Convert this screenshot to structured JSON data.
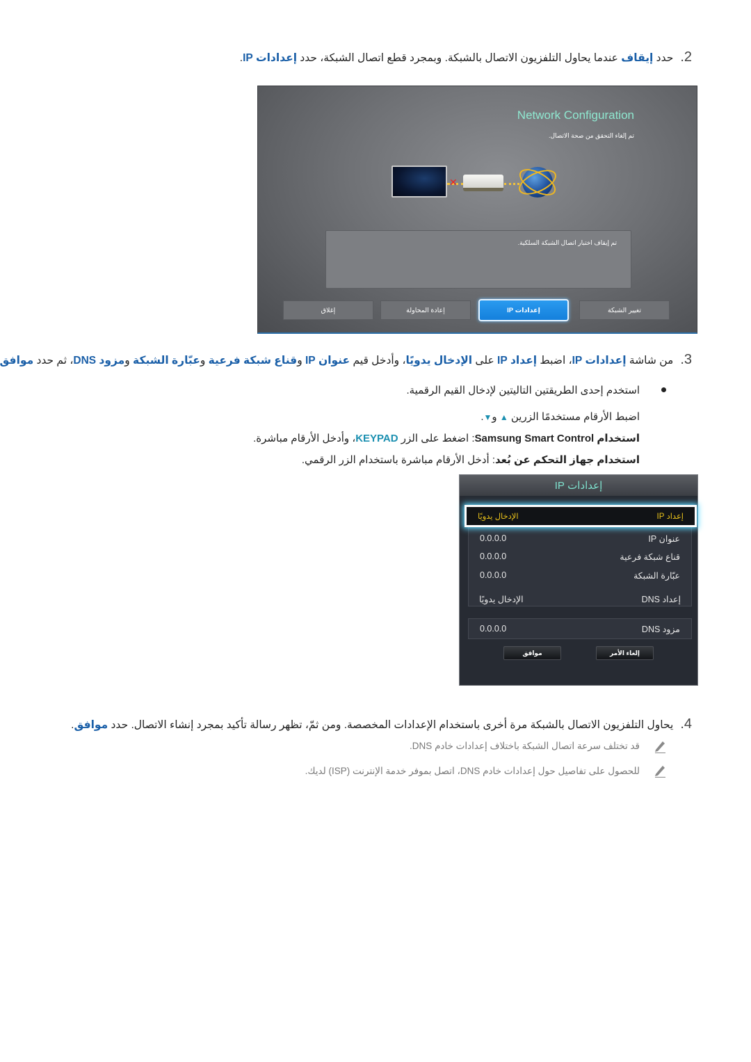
{
  "step2": {
    "number": "2.",
    "text_a": "حدد ",
    "link_stop": "إيقاف",
    "text_b": " عندما يحاول التلفزيون الاتصال بالشبكة. وبمجرد قطع اتصال الشبكة، حدد ",
    "link_ip": "إعدادات IP",
    "text_c": "."
  },
  "network_config": {
    "title": "Network Configuration",
    "subtitle": "تم إلغاء التحقق من صحة الاتصال.",
    "message": "تم إيقاف اختبار اتصال الشبكة السلكية.",
    "buttons": [
      {
        "label": "تغيير الشبكة",
        "active": false
      },
      {
        "label": "إعدادات IP",
        "active": true
      },
      {
        "label": "إعادة المحاولة",
        "active": false
      },
      {
        "label": "إغلاق",
        "active": false
      }
    ],
    "colors": {
      "title": "#8fe8d0",
      "active_button": "#1a8ae6"
    }
  },
  "step3": {
    "number": "3.",
    "t1": "من شاشة ",
    "k1": "إعدادات IP",
    "t2": "، اضبط ",
    "k2": "إعداد IP",
    "t3": " على ",
    "k3": "الإدخال يدويًا",
    "t4": "، وأدخل قيم ",
    "k4": "عنوان IP",
    "t5": " و",
    "k5": "قناع شبكة فرعية",
    "t6": " و",
    "k6": "عبّارة الشبكة",
    "t7": " و",
    "k7": "مزود DNS",
    "t8": "، ثم حدد ",
    "k8": "موافق",
    "t9": "."
  },
  "bullet": {
    "intro": "استخدم إحدى الطريقتين التاليتين لإدخال القيم الرقمية.",
    "arrows_a": "اضبط الأرقام مستخدمًا الزرين ",
    "up_icon": "▲",
    "arrows_and": " و",
    "down_icon": "▼",
    "arrows_end": ".",
    "smart_label": "استخدام Samsung Smart Control",
    "smart_a": ": اضغط على الزر ",
    "smart_key": "KEYPAD",
    "smart_b": "، وأدخل الأرقام مباشرة.",
    "remote_label": "استخدام جهاز التحكم عن بُعد",
    "remote_text": ": أدخل الأرقام مباشرة باستخدام الزر الرقمي."
  },
  "ip_settings": {
    "title": "إعدادات IP",
    "rows": [
      {
        "label": "إعداد IP",
        "value": "الإدخال يدويًا",
        "selected": true
      },
      {
        "label": "عنوان IP",
        "value": "0.0.0.0"
      },
      {
        "label": "قناع شبكة فرعية",
        "value": "0.0.0.0"
      },
      {
        "label": "عبّارة الشبكة",
        "value": "0.0.0.0"
      }
    ],
    "dns_setting": {
      "label": "إعداد DNS",
      "value": "الإدخال يدويًا"
    },
    "dns_server": {
      "label": "مزود DNS",
      "value": "0.0.0.0"
    },
    "cancel_label": "إلغاء الأمر",
    "ok_label": "موافق",
    "colors": {
      "title": "#7fe3cf",
      "selected_text": "#e9c21a"
    }
  },
  "step4": {
    "number": "4.",
    "text": "يحاول التلفزيون الاتصال بالشبكة مرة أخرى باستخدام الإعدادات المخصصة. ومن ثمّ، تظهر رسالة تأكيد بمجرد إنشاء الاتصال. حدد ",
    "link_ok": "موافق",
    "end": "."
  },
  "notes": [
    {
      "icon": "pencil-icon",
      "text": "قد تختلف سرعة اتصال الشبكة باختلاف إعدادات خادم DNS."
    },
    {
      "icon": "pencil-icon",
      "text": "للحصول على تفاصيل حول إعدادات خادم DNS، اتصل بموفر خدمة الإنترنت (ISP) لديك."
    }
  ]
}
